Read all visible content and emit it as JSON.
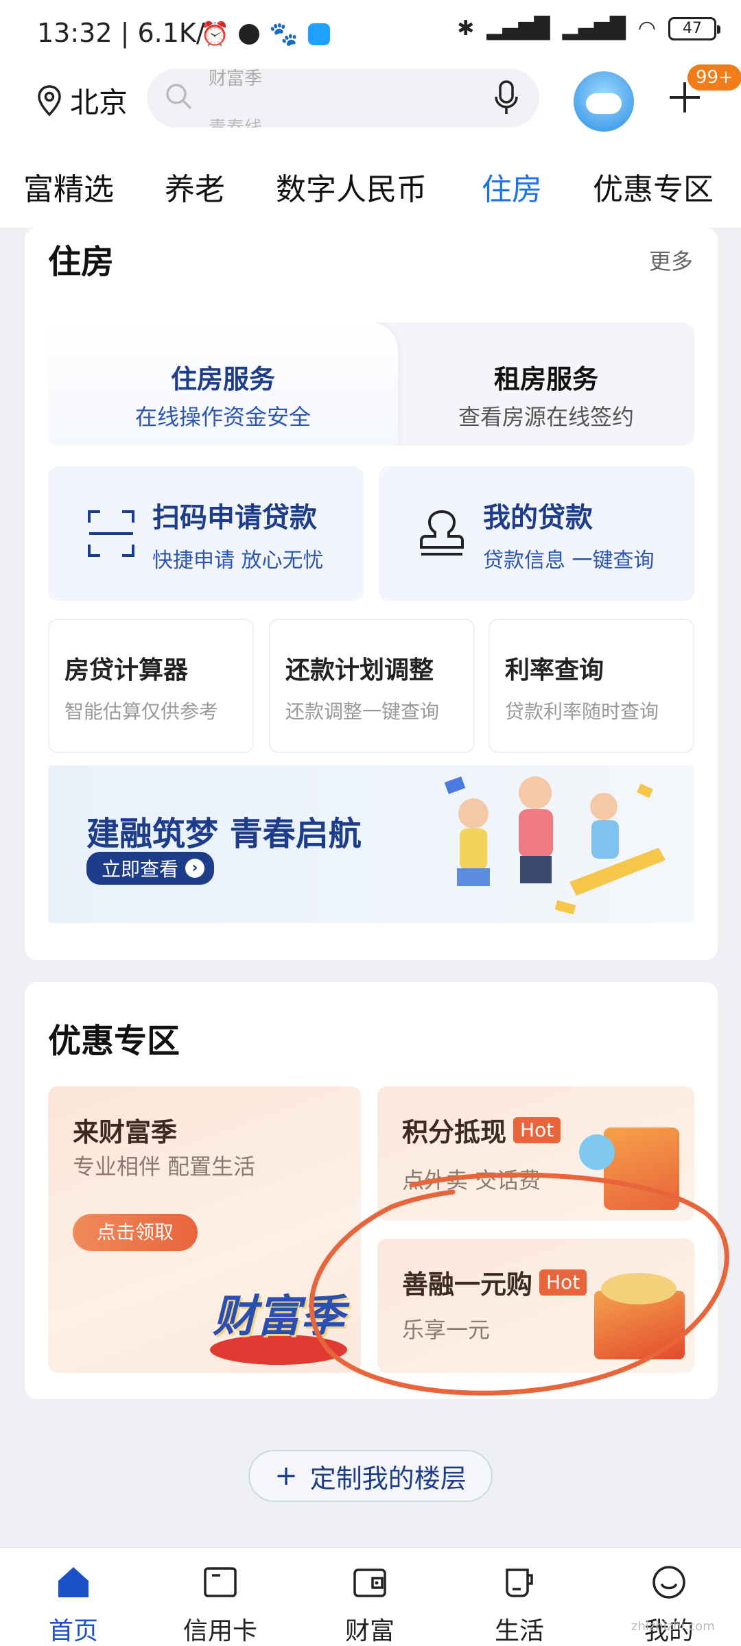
{
  "status_bar": {
    "time": "13:32",
    "speed": "| 6.1K/s",
    "battery": "47"
  },
  "header": {
    "location": "北京",
    "search_placeholder_top": "财富季",
    "search_placeholder_bottom": "青春线",
    "badge": "99+"
  },
  "tabs": [
    {
      "label": "富精选"
    },
    {
      "label": "养老"
    },
    {
      "label": "数字人民币"
    },
    {
      "label": "住房"
    },
    {
      "label": "优惠专区"
    }
  ],
  "housing": {
    "title": "住房",
    "more": "更多",
    "segments": [
      {
        "title": "住房服务",
        "subtitle": "在线操作资金安全"
      },
      {
        "title": "租房服务",
        "subtitle": "查看房源在线签约"
      }
    ],
    "tiles": [
      {
        "title": "扫码申请贷款",
        "subtitle": "快捷申请 放心无忧"
      },
      {
        "title": "我的贷款",
        "subtitle": "贷款信息 一键查询"
      }
    ],
    "minis": [
      {
        "title": "房贷计算器",
        "subtitle": "智能估算仅供参考"
      },
      {
        "title": "还款计划调整",
        "subtitle": "还款调整一键查询"
      },
      {
        "title": "利率查询",
        "subtitle": "贷款利率随时查询"
      }
    ],
    "banner": {
      "title": "建融筑梦 青春启航",
      "button": "立即查看"
    }
  },
  "promo": {
    "title": "优惠专区",
    "left": {
      "title": "来财富季",
      "subtitle": "专业相伴 配置生活",
      "button": "点击领取",
      "art_text": "财富季"
    },
    "right_top": {
      "title": "积分抵现",
      "hot": "Hot",
      "subtitle": "点外卖 交话费"
    },
    "right_bottom": {
      "title": "善融一元购",
      "hot": "Hot",
      "subtitle": "乐享一元"
    }
  },
  "floor_button": "定制我的楼层",
  "bottom_nav": [
    {
      "label": "首页"
    },
    {
      "label": "信用卡"
    },
    {
      "label": "财富"
    },
    {
      "label": "生活"
    },
    {
      "label": "我的"
    }
  ],
  "colors": {
    "accent": "#1a73e8",
    "navy": "#1d3c8a",
    "hot": "#e8643a",
    "annotation": "#e8643a"
  },
  "watermark": "zhizhizhi.com"
}
